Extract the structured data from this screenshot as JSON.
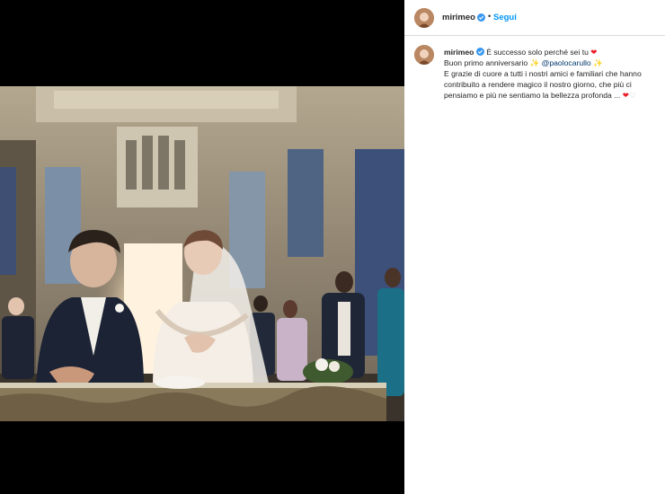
{
  "post": {
    "username": "mirimeo",
    "follow_label": "Segui",
    "separator": "•",
    "caption": {
      "line1": "È successo solo perché sei tu",
      "line1_emoji": "❤",
      "line2_pre": "Buon primo anniversario",
      "line2_emoji_a": "✨",
      "mention": "@paolocarullo",
      "line2_emoji_b": "✨",
      "line3": "E grazie di cuore a tutti i nostri amici e familiari che hanno contribuito a rendere magico il nostro giorno, che più ci pensiamo e più ne sentiamo la bellezza profonda ...",
      "end_emoji_a": "❤",
      "end_emoji_b": "♡"
    }
  },
  "colors": {
    "follow": "#0095f6",
    "verified": "#3897f0",
    "mention": "#00376b",
    "heart": "#ed1c24"
  },
  "icons": [
    "verified-badge-icon",
    "heart-emoji",
    "sparkles-emoji",
    "white-heart-emoji"
  ]
}
